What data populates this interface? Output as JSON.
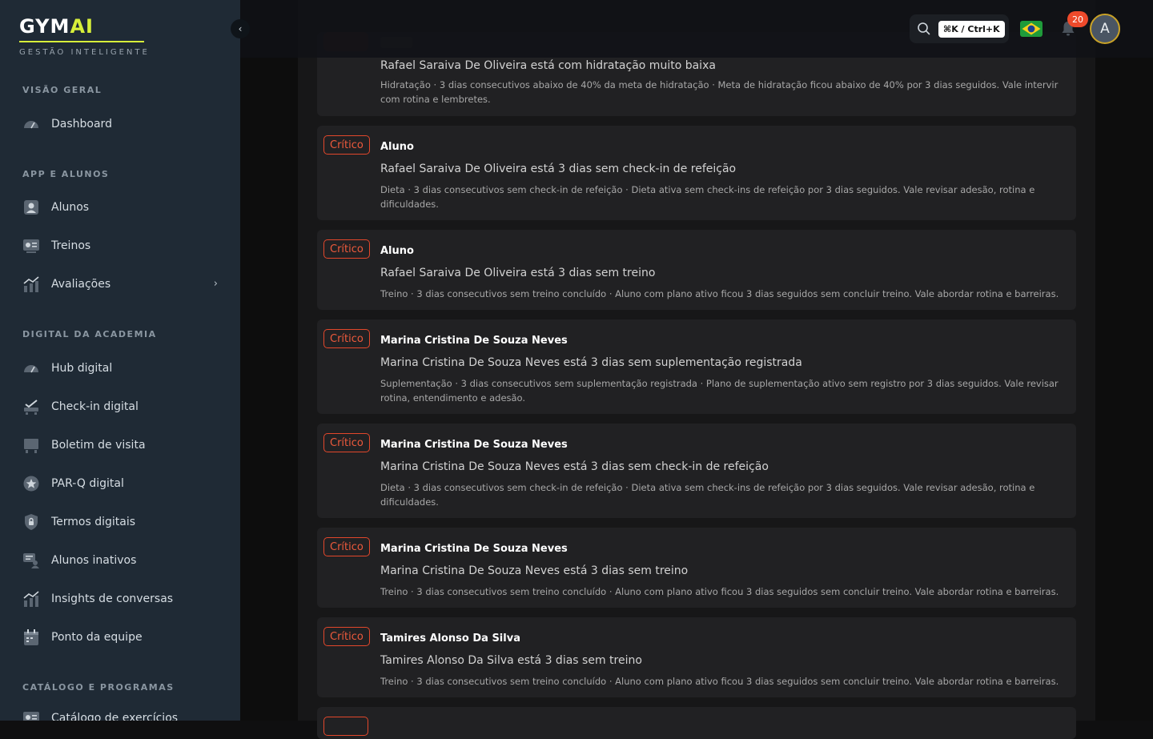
{
  "brand": {
    "name": "GYM",
    "name_accent": "AI",
    "tagline": "GESTÃO INTELIGENTE"
  },
  "sidebar": {
    "collapse_icon": "chevron-left-icon",
    "sections": [
      {
        "label": "VISÃO GERAL",
        "items": [
          {
            "label": "Dashboard",
            "icon": "dashboard-icon"
          }
        ]
      },
      {
        "label": "APP E ALUNOS",
        "items": [
          {
            "label": "Alunos",
            "icon": "person-icon"
          },
          {
            "label": "Treinos",
            "icon": "workout-icon"
          },
          {
            "label": "Avaliações",
            "icon": "chart-icon",
            "has_submenu": true
          }
        ]
      },
      {
        "label": "DIGITAL DA ACADEMIA",
        "items": [
          {
            "label": "Hub digital",
            "icon": "hub-icon"
          },
          {
            "label": "Check-in digital",
            "icon": "checkin-icon"
          },
          {
            "label": "Boletim de visita",
            "icon": "report-icon"
          },
          {
            "label": "PAR-Q digital",
            "icon": "star-badge-icon"
          },
          {
            "label": "Termos digitais",
            "icon": "lock-shield-icon"
          },
          {
            "label": "Alunos inativos",
            "icon": "chat-person-icon"
          },
          {
            "label": "Insights de conversas",
            "icon": "insights-icon"
          },
          {
            "label": "Ponto da equipe",
            "icon": "calendar-icon"
          }
        ]
      },
      {
        "label": "CATÁLOGO E PROGRAMAS",
        "items": [
          {
            "label": "Catálogo de exercícios",
            "icon": "catalog-icon"
          }
        ]
      }
    ]
  },
  "topbar": {
    "search_shortcut": "⌘K / Ctrl+K",
    "language_flag": "brazil-flag-icon",
    "notification_count": "20",
    "avatar_initial": "A"
  },
  "alerts": [
    {
      "severity": "",
      "title": "",
      "message": "Rafael Saraiva De Oliveira está com hidratação muito baixa",
      "detail": "Hidratação · 3 dias consecutivos abaixo de 40% da meta de hidratação · Meta de hidratação ficou abaixo de 40% por 3 dias seguidos. Vale intervir com rotina e lembretes."
    },
    {
      "severity": "Crítico",
      "title": "Aluno",
      "message": "Rafael Saraiva De Oliveira está 3 dias sem check-in de refeição",
      "detail": "Dieta · 3 dias consecutivos sem check-in de refeição · Dieta ativa sem check-ins de refeição por 3 dias seguidos. Vale revisar adesão, rotina e dificuldades."
    },
    {
      "severity": "Crítico",
      "title": "Aluno",
      "message": "Rafael Saraiva De Oliveira está 3 dias sem treino",
      "detail": "Treino · 3 dias consecutivos sem treino concluído · Aluno com plano ativo ficou 3 dias seguidos sem concluir treino. Vale abordar rotina e barreiras."
    },
    {
      "severity": "Crítico",
      "title": "Marina Cristina De Souza Neves",
      "message": "Marina Cristina De Souza Neves está 3 dias sem suplementação registrada",
      "detail": "Suplementação · 3 dias consecutivos sem suplementação registrada · Plano de suplementação ativo sem registro por 3 dias seguidos. Vale revisar rotina, entendimento e adesão."
    },
    {
      "severity": "Crítico",
      "title": "Marina Cristina De Souza Neves",
      "message": "Marina Cristina De Souza Neves está 3 dias sem check-in de refeição",
      "detail": "Dieta · 3 dias consecutivos sem check-in de refeição · Dieta ativa sem check-ins de refeição por 3 dias seguidos. Vale revisar adesão, rotina e dificuldades."
    },
    {
      "severity": "Crítico",
      "title": "Marina Cristina De Souza Neves",
      "message": "Marina Cristina De Souza Neves está 3 dias sem treino",
      "detail": "Treino · 3 dias consecutivos sem treino concluído · Aluno com plano ativo ficou 3 dias seguidos sem concluir treino. Vale abordar rotina e barreiras."
    },
    {
      "severity": "Crítico",
      "title": "Tamires Alonso Da Silva",
      "message": "Tamires Alonso Da Silva está 3 dias sem treino",
      "detail": "Treino · 3 dias consecutivos sem treino concluído · Aluno com plano ativo ficou 3 dias seguidos sem concluir treino. Vale abordar rotina e barreiras."
    }
  ],
  "colors": {
    "accent": "#d7ef3a",
    "critical": "#ee5a3c",
    "sidebar_bg": "#1f2a35"
  }
}
